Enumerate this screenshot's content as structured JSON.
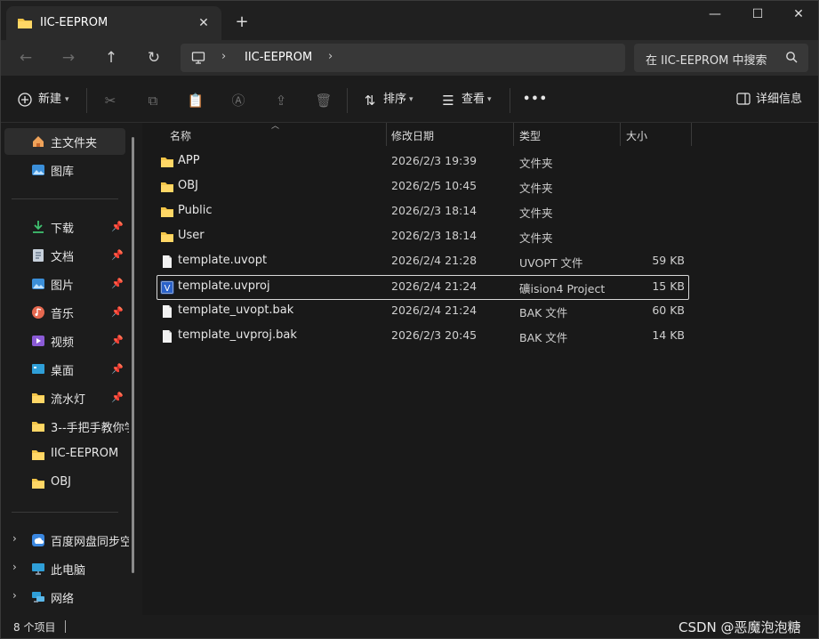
{
  "window": {
    "tab_title": "IIC-EEPROM",
    "tab_close": "✕",
    "new_tab": "+",
    "minimize": "—",
    "maximize": "☐",
    "close": "✕"
  },
  "nav": {
    "back": "←",
    "forward": "→",
    "up": "↑",
    "refresh": "↻",
    "breadcrumb": "IIC-EEPROM",
    "chevron": "›",
    "search_placeholder": "在 IIC-EEPROM 中搜索"
  },
  "toolbar": {
    "new_label": "新建",
    "sort_label": "排序",
    "view_label": "查看",
    "more": "•••",
    "details_label": "详细信息"
  },
  "sidebar": {
    "home": "主文件夹",
    "gallery": "图库",
    "quick": [
      {
        "label": "下载",
        "icon": "download-icon"
      },
      {
        "label": "文档",
        "icon": "document-icon"
      },
      {
        "label": "图片",
        "icon": "pictures-icon"
      },
      {
        "label": "音乐",
        "icon": "music-icon"
      },
      {
        "label": "视频",
        "icon": "video-icon"
      },
      {
        "label": "桌面",
        "icon": "desktop-icon"
      },
      {
        "label": "流水灯",
        "icon": "folder-icon"
      }
    ],
    "recent": [
      "3--手把手教你学",
      "IIC-EEPROM",
      "OBJ"
    ],
    "roots": [
      "百度网盘同步空",
      "此电脑",
      "网络"
    ],
    "pin": "📌",
    "expand": "›"
  },
  "columns": {
    "name": "名称",
    "date": "修改日期",
    "type": "类型",
    "size": "大小"
  },
  "files": [
    {
      "name": "APP",
      "date": "2026/2/3 19:39",
      "type": "文件夹",
      "size": "",
      "kind": "folder"
    },
    {
      "name": "OBJ",
      "date": "2026/2/5 10:45",
      "type": "文件夹",
      "size": "",
      "kind": "folder"
    },
    {
      "name": "Public",
      "date": "2026/2/3 18:14",
      "type": "文件夹",
      "size": "",
      "kind": "folder"
    },
    {
      "name": "User",
      "date": "2026/2/3 18:14",
      "type": "文件夹",
      "size": "",
      "kind": "folder"
    },
    {
      "name": "template.uvopt",
      "date": "2026/2/4 21:28",
      "type": "UVOPT 文件",
      "size": "59 KB",
      "kind": "file"
    },
    {
      "name": "template.uvproj",
      "date": "2026/2/4 21:24",
      "type": "礦ision4 Project",
      "size": "15 KB",
      "kind": "uvproj"
    },
    {
      "name": "template_uvopt.bak",
      "date": "2026/2/4 21:24",
      "type": "BAK 文件",
      "size": "60 KB",
      "kind": "file"
    },
    {
      "name": "template_uvproj.bak",
      "date": "2026/2/3 20:45",
      "type": "BAK 文件",
      "size": "14 KB",
      "kind": "file"
    }
  ],
  "status": {
    "count": "8 个项目"
  },
  "watermark": "CSDN @恶魔泡泡糖"
}
